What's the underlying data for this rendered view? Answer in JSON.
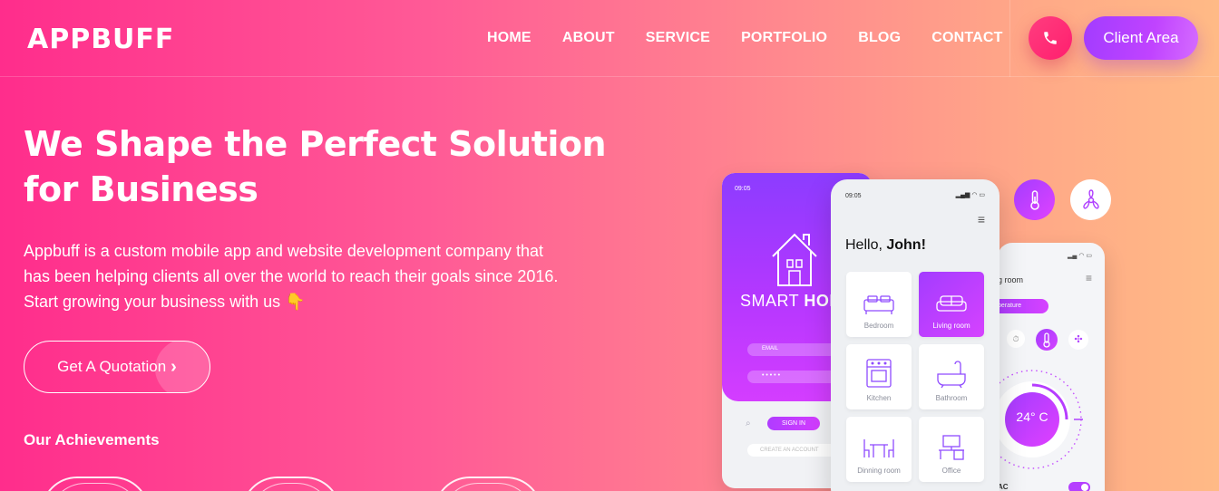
{
  "brand": {
    "logo": "APPBUFF"
  },
  "nav": {
    "items": [
      "HOME",
      "ABOUT",
      "SERVICE",
      "PORTFOLIO",
      "BLOG",
      "CONTACT"
    ]
  },
  "header": {
    "client_area_label": "Client Area",
    "phone_icon": "phone-icon"
  },
  "hero": {
    "title_line1": "We Shape the Perfect Solution",
    "title_line2": "for Business",
    "desc_line1": "Appbuff is a custom mobile app and website development company that",
    "desc_line2": "has been helping clients all over the world to reach their goals since 2016.",
    "desc_line3": "Start growing your business with us",
    "emoji": "👇",
    "cta_label": "Get A Quotation",
    "cta_arrow": "›"
  },
  "achievements": {
    "title": "Our Achievements"
  },
  "mockup": {
    "phone1": {
      "time": "09:05",
      "brand_a": "SMART ",
      "brand_b": "HOM",
      "email_label": "EMAIL",
      "password_dots": "• • • • •",
      "signin": "SIGN IN",
      "create": "CREATE AN ACCOUNT"
    },
    "phone2": {
      "time": "09:05",
      "greeting": "Hello, ",
      "name": "John!",
      "rooms": [
        "Bedroom",
        "Living room",
        "Kitchen",
        "Bathroom",
        "Dinning room",
        "Office"
      ]
    },
    "phone3": {
      "room": "g room",
      "pill": "perature",
      "temp": "24° C",
      "ac": "AC"
    }
  },
  "colors": {
    "accent_purple": "#b537ff",
    "accent_pink": "#ff2d8c"
  }
}
